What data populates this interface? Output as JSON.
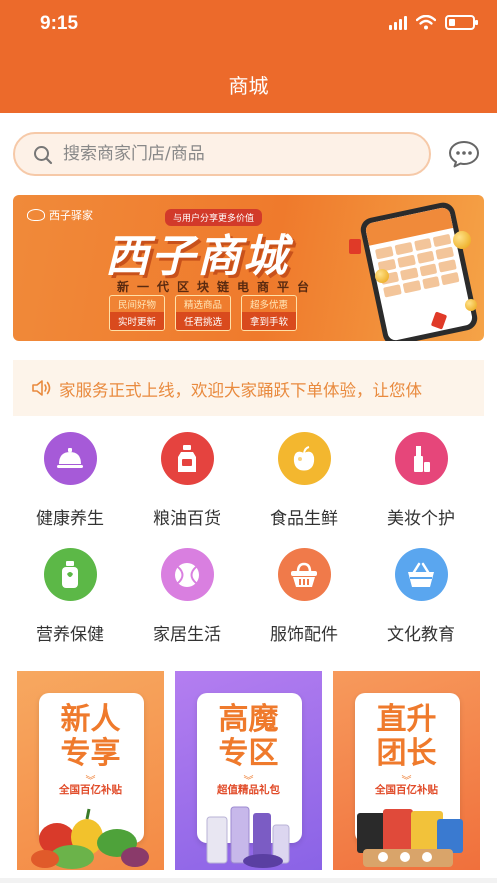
{
  "status_bar": {
    "time": "9:15"
  },
  "header": {
    "title": "商城"
  },
  "search": {
    "placeholder": "搜索商家门店/商品"
  },
  "icons": {
    "search": "search-icon",
    "message": "chat-bubble-icon",
    "notice": "speaker-icon"
  },
  "banner": {
    "logo_text": "西子驿家",
    "tag": "与用户分享更多价值",
    "title": "西子商城",
    "subtitle": "新一代区块链电商平台",
    "pills": [
      {
        "top": "民间好物",
        "bottom": "实时更新"
      },
      {
        "top": "精选商品",
        "bottom": "任君挑选"
      },
      {
        "top": "超多优惠",
        "bottom": "拿到手软"
      }
    ]
  },
  "notice": {
    "text": "家服务正式上线，欢迎大家踊跃下单体验，让您体"
  },
  "categories": [
    {
      "label": "健康养生",
      "icon": "food-cloche-icon",
      "color": "#a65ad8"
    },
    {
      "label": "粮油百货",
      "icon": "oil-bottle-icon",
      "color": "#e5433f"
    },
    {
      "label": "食品生鲜",
      "icon": "apple-icon",
      "color": "#f3b72f"
    },
    {
      "label": "美妆个护",
      "icon": "lipstick-icon",
      "color": "#e6467a"
    },
    {
      "label": "营养保健",
      "icon": "supplement-bottle-icon",
      "color": "#5cb847"
    },
    {
      "label": "家居生活",
      "icon": "ball-icon",
      "color": "#d97fe0"
    },
    {
      "label": "服饰配件",
      "icon": "basket-icon",
      "color": "#f07a4a"
    },
    {
      "label": "文化教育",
      "icon": "shopping-basket-icon",
      "color": "#5aa6ef"
    }
  ],
  "promos": [
    {
      "title": "新人\n专享",
      "subtitle": "全国百亿补贴"
    },
    {
      "title": "高魔\n专区",
      "subtitle": "超值精品礼包"
    },
    {
      "title": "直升\n团长",
      "subtitle": "全国百亿补贴"
    }
  ],
  "colors": {
    "brand": "#ec6a2b",
    "notice_text": "#e98a3e",
    "promo_text": "#ef7a2c"
  }
}
